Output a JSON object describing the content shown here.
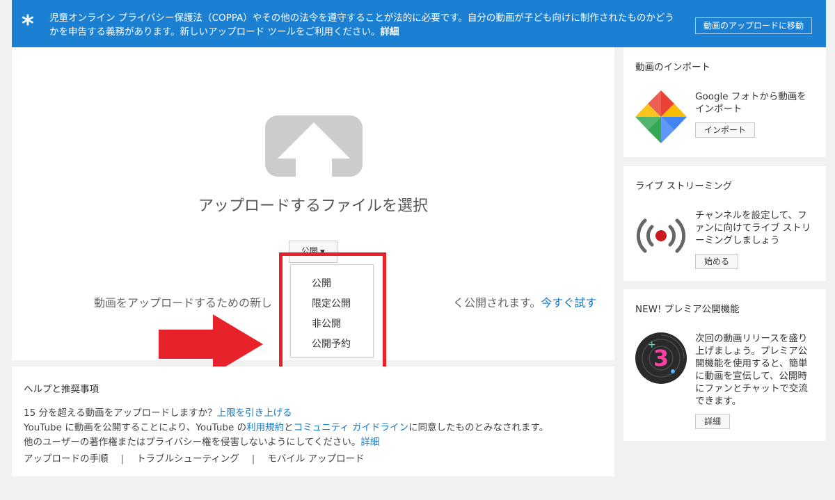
{
  "banner": {
    "text": "児童オンライン プライバシー保護法（COPPA）やその他の法令を遵守することが法的に必要です。自分の動画が子ども向けに制作されたものかどうかを申告する義務があります。新しいアップロード ツールをご利用ください。",
    "link": "詳細",
    "button": "動画のアップロードに移動"
  },
  "upload": {
    "title": "アップロードするファイルを選択",
    "privacy_value": "公開",
    "privacy_options": [
      "公開",
      "限定公開",
      "非公開",
      "公開予約"
    ],
    "notice_start": "動画をアップロードするための新し",
    "notice_end": "く公開されます。",
    "notice_link": "今すぐ試す"
  },
  "help": {
    "title": "ヘルプと推奨事項",
    "line1_text": "15 分を超える動画をアップロードしますか？",
    "line1_link": "上限を引き上げる",
    "line2_a": "YouTube に動画を公開することにより、YouTube の",
    "line2_link1": "利用規約",
    "line2_b": "と",
    "line2_link2": "コミュニティ ガイドライン",
    "line2_c": "に同意したものとみなされます。",
    "line3_text": "他のユーザーの著作権またはプライバシー権を侵害しないようにしてください。",
    "line3_link": "詳細",
    "links": [
      "アップロードの手順",
      "トラブルシューティング",
      "モバイル アップロード"
    ]
  },
  "sidebar": {
    "import": {
      "title": "動画のインポート",
      "text": "Google フォトから動画をインポート",
      "button": "インポート"
    },
    "live": {
      "title": "ライブ ストリーミング",
      "text": "チャンネルを設定して、ファンに向けてライブ ストリーミングしましょう",
      "button": "始める"
    },
    "premiere": {
      "title": "NEW! プレミア公開機能",
      "text": "次回の動画リリースを盛り上げましょう。プレミア公開機能を使用すると、簡単に動画を宣伝して、公開時にファンとチャットで交流できます。",
      "button": "詳細",
      "icon_number": "3"
    }
  },
  "colors": {
    "banner_bg": "#1b7fd2",
    "link": "#167ac6",
    "highlight_red": "#e8222a",
    "page_bg": "#f1f1f1"
  }
}
